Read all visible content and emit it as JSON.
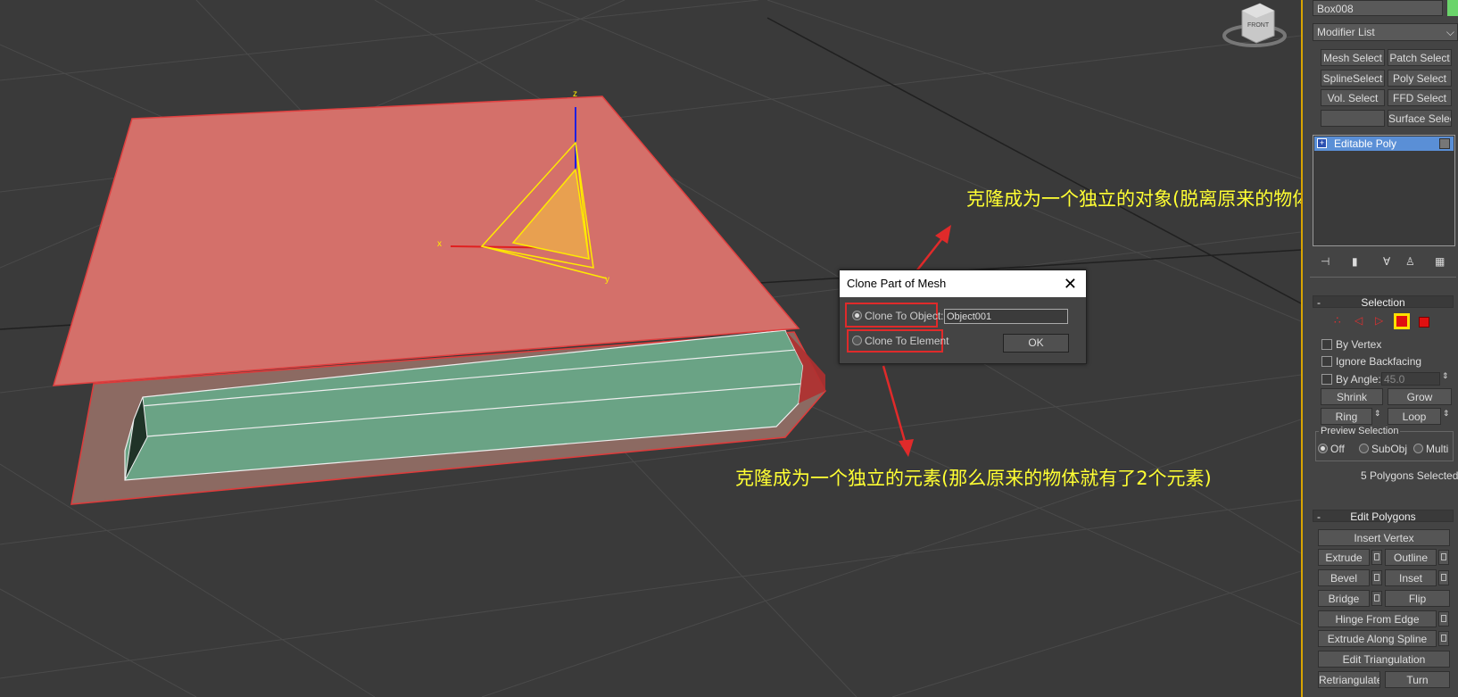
{
  "viewport": {
    "annotation_object": "克隆成为一个独立的对象(脱离原来的物体)",
    "annotation_element": "克隆成为一个独立的元素(那么原来的物体就有了2个元素)",
    "viewcube_label": "FRONT",
    "gizmo_z": "z",
    "gizmo_x": "x",
    "gizmo_y": "y"
  },
  "dialog": {
    "title": "Clone Part of Mesh",
    "close": "✕",
    "option_object": "Clone To Object:",
    "option_element": "Clone To Element",
    "object_name": "Object001",
    "ok": "OK"
  },
  "panel": {
    "object_name": "Box008",
    "modifier_list": "Modifier List",
    "modifier_buttons": [
      "Mesh Select",
      "Patch Select",
      "SplineSelect",
      "Poly Select",
      "Vol. Select",
      "FFD Select",
      "",
      "Surface Select"
    ],
    "stack_item": "Editable Poly",
    "selection": {
      "header": "Selection",
      "collapse": "-",
      "by_vertex": "By Vertex",
      "ignore_backfacing": "Ignore Backfacing",
      "by_angle": "By Angle:",
      "angle_value": "45.0",
      "shrink": "Shrink",
      "grow": "Grow",
      "ring": "Ring",
      "loop": "Loop",
      "preview_label": "Preview Selection",
      "preview_off": "Off",
      "preview_subobj": "SubObj",
      "preview_multi": "Multi",
      "status": "5 Polygons Selected"
    },
    "edit_polygons": {
      "header": "Edit Polygons",
      "collapse": "-",
      "insert_vertex": "Insert Vertex",
      "extrude": "Extrude",
      "outline": "Outline",
      "bevel": "Bevel",
      "inset": "Inset",
      "bridge": "Bridge",
      "flip": "Flip",
      "hinge_from_edge": "Hinge From Edge",
      "extrude_along_spline": "Extrude Along Spline",
      "edit_triangulation": "Edit Triangulation",
      "retriangulate": "Retriangulate",
      "turn": "Turn"
    }
  },
  "colors": {
    "annotation": "#ffff33",
    "highlight_box": "#e02a2a",
    "selected_face": "#d4706a",
    "box_side": "#6aa385",
    "panel_accent": "#d8a400"
  }
}
